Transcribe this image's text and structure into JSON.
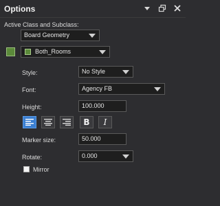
{
  "window": {
    "title": "Options"
  },
  "titlebar_icons": [
    "dropdown-menu-icon",
    "restore-icon",
    "close-icon"
  ],
  "active_class": {
    "label": "Active Class and Subclass:",
    "class_value": "Board Geometry",
    "subclass_value": "Both_Rooms",
    "color": "#5b8a3a"
  },
  "style": {
    "label": "Style:",
    "value": "No Style"
  },
  "font": {
    "label": "Font:",
    "value": "Agency FB"
  },
  "height": {
    "label": "Height:",
    "value": "100.000"
  },
  "formatting": {
    "buttons": [
      "align-left-icon",
      "align-center-icon",
      "align-right-icon",
      "bold-icon",
      "italic-icon"
    ],
    "bold_glyph": "B",
    "italic_glyph": "I",
    "active": "align-left"
  },
  "marker_size": {
    "label": "Marker size:",
    "value": "50.000"
  },
  "rotate": {
    "label": "Rotate:",
    "value": "0.000"
  },
  "mirror": {
    "label": "Mirror",
    "checked": false
  }
}
